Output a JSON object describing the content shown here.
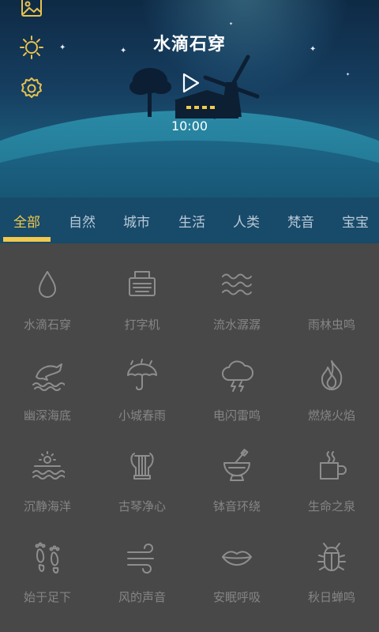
{
  "app": {
    "title": "水滴石穿",
    "time": "10:00"
  },
  "side_icons": [
    "image-icon",
    "brightness-icon",
    "settings-icon"
  ],
  "colors": {
    "accent": "#f2c94c",
    "tab_bar": "#184a6a",
    "grid_bg": "#484848",
    "icon_gray": "#8e8e8e",
    "label_gray": "#858585"
  },
  "tabs": [
    {
      "label": "全部",
      "active": true
    },
    {
      "label": "自然",
      "active": false
    },
    {
      "label": "城市",
      "active": false
    },
    {
      "label": "生活",
      "active": false
    },
    {
      "label": "人类",
      "active": false
    },
    {
      "label": "梵音",
      "active": false
    },
    {
      "label": "宝宝",
      "active": false
    }
  ],
  "sounds": [
    {
      "label": "水滴石穿",
      "icon": "water-drop-icon"
    },
    {
      "label": "打字机",
      "icon": "typewriter-icon"
    },
    {
      "label": "流水潺潺",
      "icon": "waves-icon"
    },
    {
      "label": "雨林虫鸣",
      "icon": "rainforest-icon"
    },
    {
      "label": "幽深海底",
      "icon": "dolphin-icon"
    },
    {
      "label": "小城春雨",
      "icon": "umbrella-icon"
    },
    {
      "label": "电闪雷鸣",
      "icon": "thunderstorm-icon"
    },
    {
      "label": "燃烧火焰",
      "icon": "flame-icon"
    },
    {
      "label": "沉静海洋",
      "icon": "sunset-sea-icon"
    },
    {
      "label": "古琴净心",
      "icon": "lyre-icon"
    },
    {
      "label": "钵音环绕",
      "icon": "mortar-bowl-icon"
    },
    {
      "label": "生命之泉",
      "icon": "hot-cup-icon"
    },
    {
      "label": "始于足下",
      "icon": "footprints-icon"
    },
    {
      "label": "风的声音",
      "icon": "wind-icon"
    },
    {
      "label": "安眠呼吸",
      "icon": "lips-icon"
    },
    {
      "label": "秋日蝉鸣",
      "icon": "bug-icon"
    }
  ]
}
